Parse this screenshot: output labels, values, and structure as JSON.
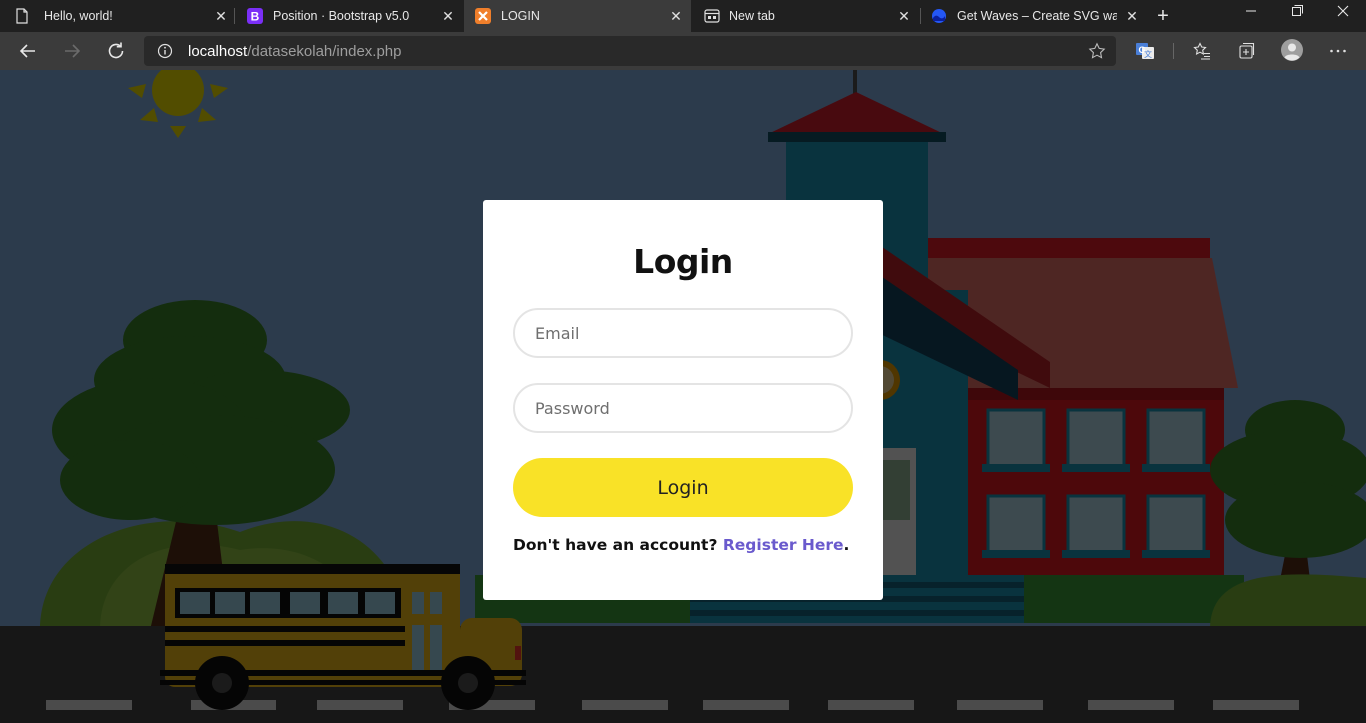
{
  "browser": {
    "tabs": [
      {
        "title": "Hello, world!",
        "favicon": "page-icon"
      },
      {
        "title": "Position · Bootstrap v5.0",
        "favicon": "bootstrap-icon"
      },
      {
        "title": "LOGIN",
        "favicon": "xampp-icon",
        "active": true
      },
      {
        "title": "New tab",
        "favicon": "newtab-icon"
      },
      {
        "title": "Get Waves – Create SVG waves",
        "favicon": "waves-icon"
      }
    ],
    "address": {
      "host": "localhost",
      "path": "/datasekolah/index.php"
    }
  },
  "login": {
    "title": "Login",
    "email_placeholder": "Email",
    "password_placeholder": "Password",
    "submit_label": "Login",
    "register_prompt": "Don't have an account? ",
    "register_link": "Register Here",
    "register_suffix": "."
  },
  "colors": {
    "button": "#f9e227",
    "link": "#6a5acd",
    "overlay": "rgba(0,0,0,0.68)"
  }
}
